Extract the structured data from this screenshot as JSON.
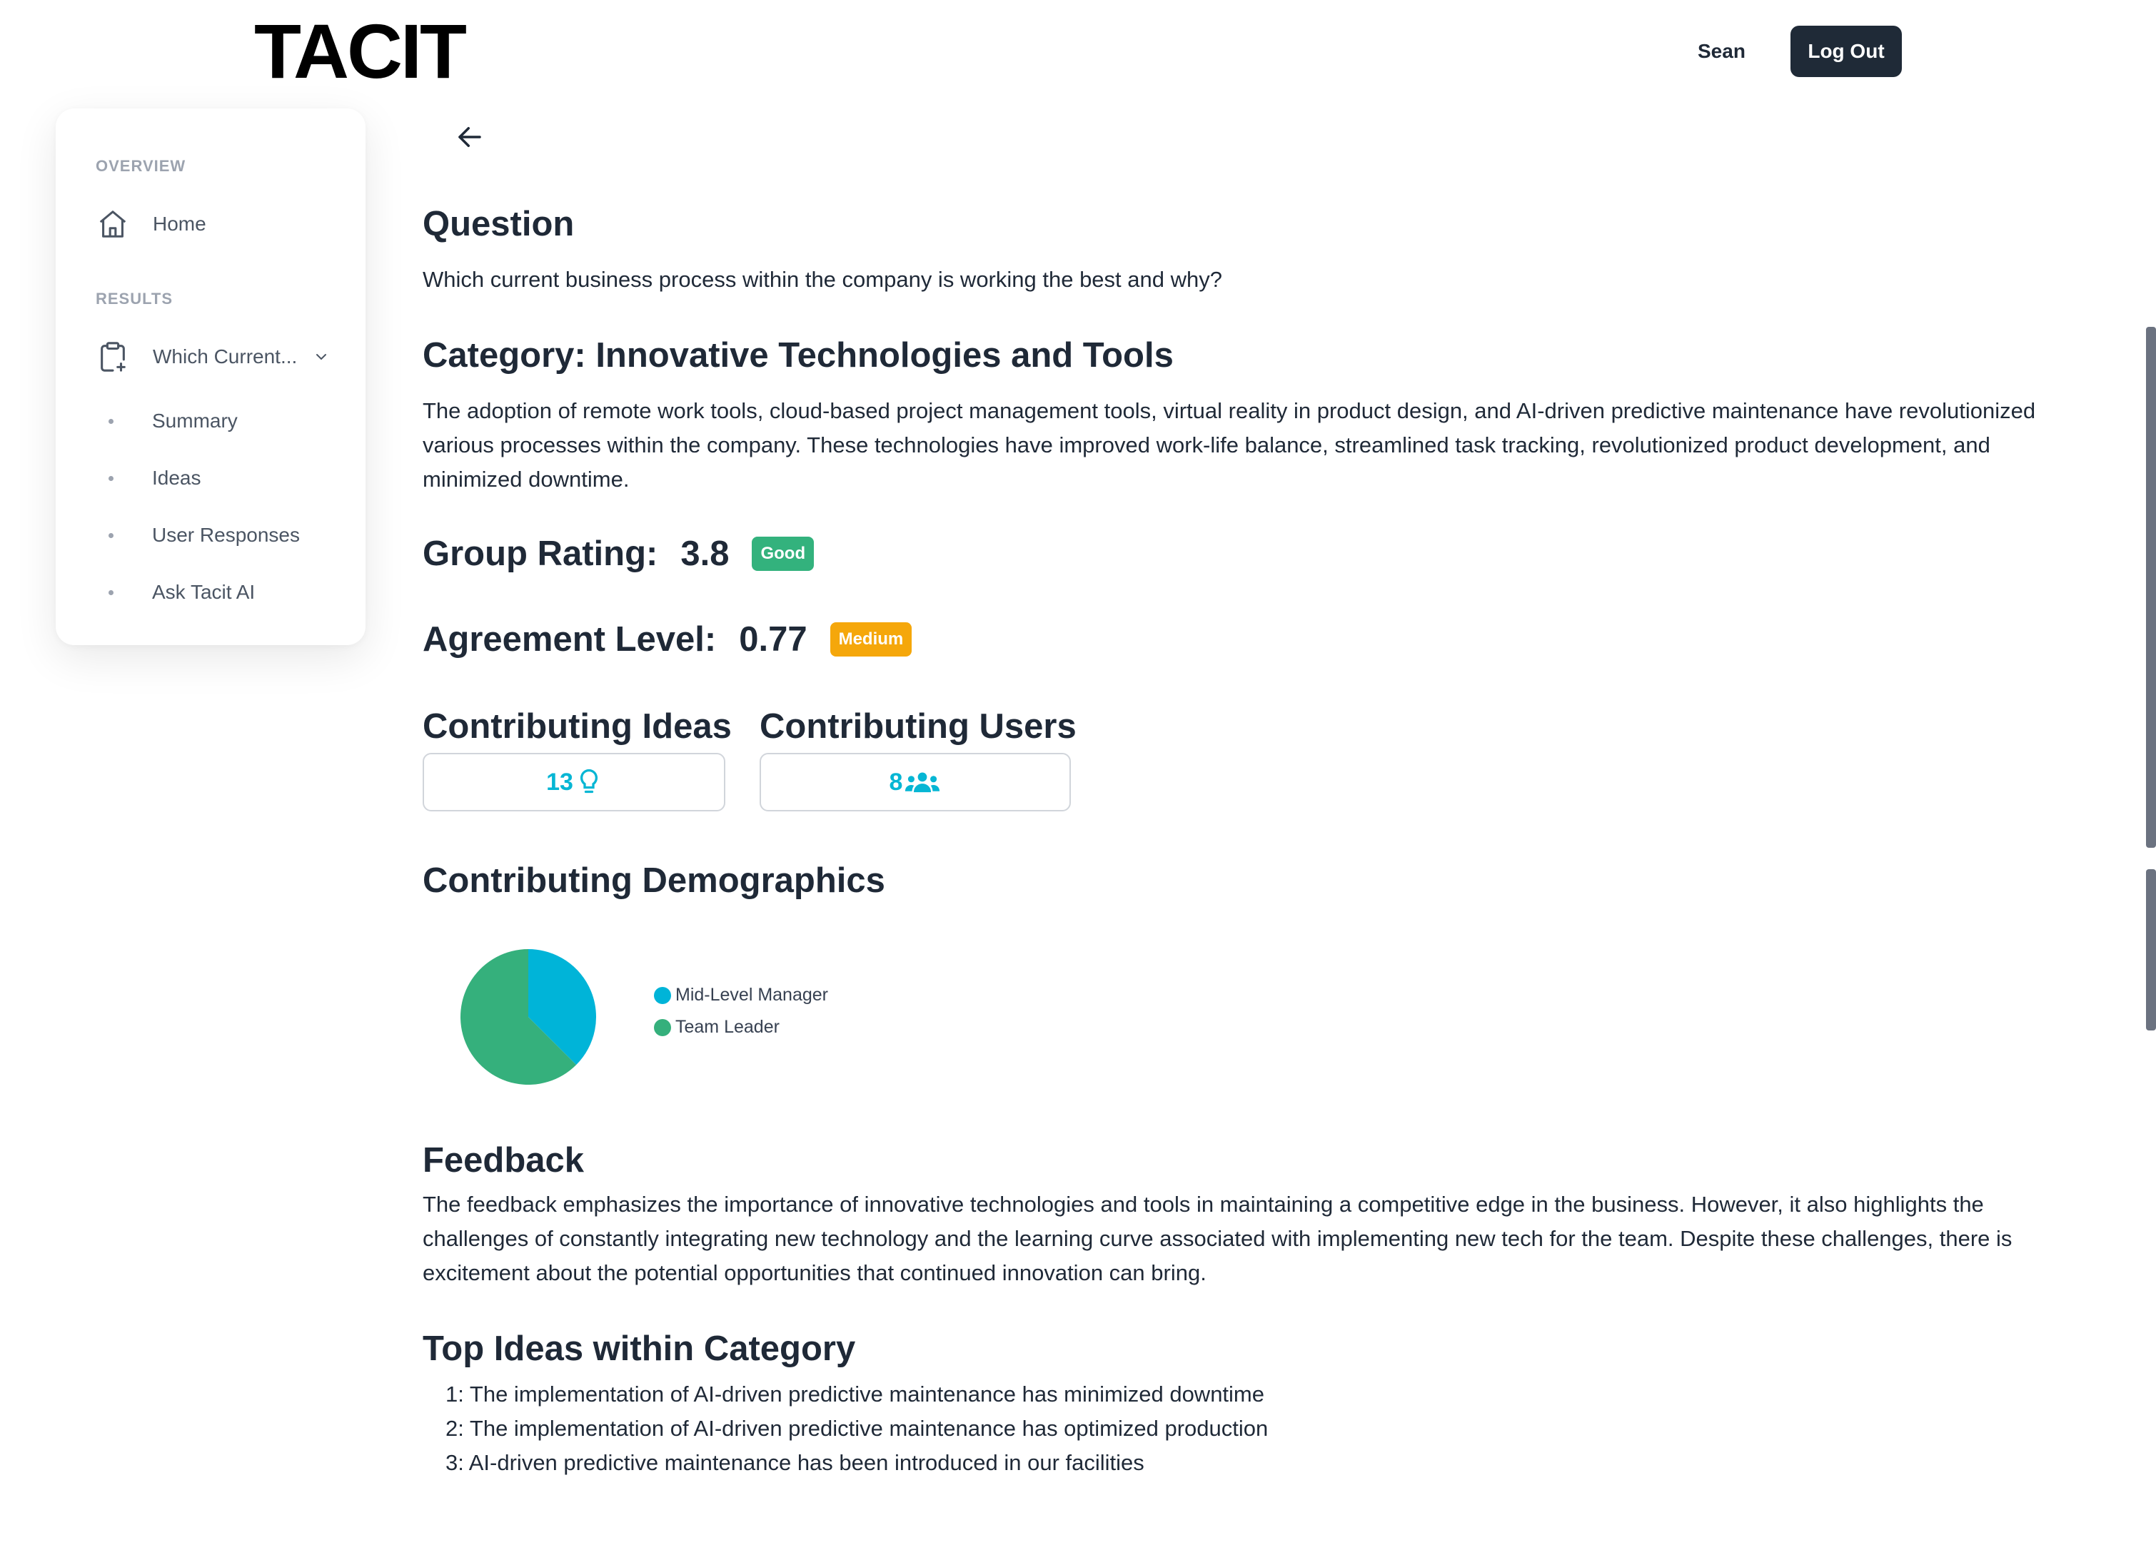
{
  "header": {
    "logo": "TACIT",
    "user_name": "Sean",
    "logout_label": "Log Out"
  },
  "sidebar": {
    "overview_label": "OVERVIEW",
    "home_label": "Home",
    "results_label": "RESULTS",
    "question_short": "Which Current...",
    "sub_items": [
      {
        "label": "Summary"
      },
      {
        "label": "Ideas"
      },
      {
        "label": "User Responses"
      },
      {
        "label": "Ask Tacit AI"
      }
    ]
  },
  "main": {
    "question_heading": "Question",
    "question_text": "Which current business process within the company is working the best and why?",
    "category_heading": "Category: Innovative Technologies and Tools",
    "category_text": "The adoption of remote work tools, cloud-based project management tools, virtual reality in product design, and AI-driven predictive maintenance have revolutionized various processes within the company. These technologies have improved work-life balance, streamlined task tracking, revolutionized product development, and minimized downtime.",
    "group_rating": {
      "label": "Group Rating:",
      "value": "3.8",
      "badge": "Good",
      "badge_color": "#33b27d"
    },
    "agreement": {
      "label": "Agreement Level:",
      "value": "0.77",
      "badge": "Medium",
      "badge_color": "#f5a70b"
    },
    "contrib_ideas": {
      "label": "Contributing Ideas",
      "count": "13",
      "icon": "lightbulb-icon"
    },
    "contrib_users": {
      "label": "Contributing Users",
      "count": "8",
      "icon": "users-icon"
    },
    "demographics_heading": "Contributing Demographics",
    "feedback_heading": "Feedback",
    "feedback_text": "The feedback emphasizes the importance of innovative technologies and tools in maintaining a competitive edge in the business. However, it also highlights the challenges of constantly integrating new technology and the learning curve associated with implementing new tech for the team. Despite these challenges, there is excitement about the potential opportunities that continued innovation can bring.",
    "top_ideas_heading": "Top Ideas within Category",
    "top_ideas": [
      "1: The implementation of AI-driven predictive maintenance has minimized downtime",
      "2: The implementation of AI-driven predictive maintenance has optimized production",
      "3: AI-driven predictive maintenance has been introduced in our facilities"
    ]
  },
  "chart_data": {
    "type": "pie",
    "categories": [
      "Mid-Level Manager",
      "Team Leader"
    ],
    "values": [
      37.5,
      62.5
    ],
    "colors": [
      "#00b4d8",
      "#35b07c"
    ],
    "legend": "right"
  }
}
